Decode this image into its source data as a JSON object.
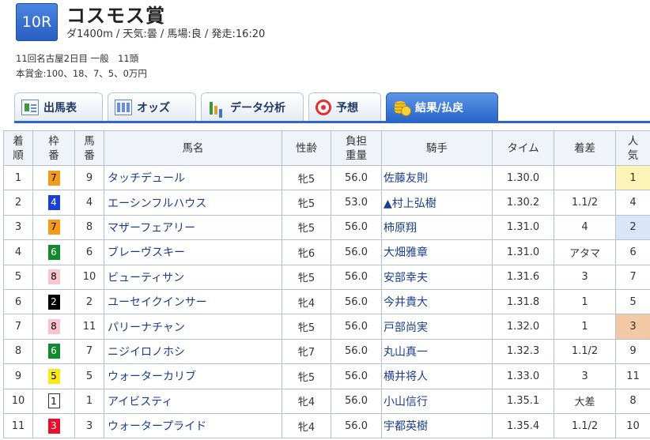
{
  "race": {
    "number": "10R",
    "name": "コスモス賞",
    "conditions": "ダ1400m / 天気:曇 / 馬場:良 / 発走:16:20",
    "meeting": "11回名古屋2日目 一般　11頭",
    "prize": "本賞金:100、18、7、5、0万円"
  },
  "tabs": [
    {
      "label": "出馬表",
      "icon": "race-card-icon"
    },
    {
      "label": "オッズ",
      "icon": "odds-icon"
    },
    {
      "label": "データ分析",
      "icon": "bar-chart-icon"
    },
    {
      "label": "予想",
      "icon": "target-icon"
    },
    {
      "label": "結果/払戻",
      "icon": "coins-icon",
      "active": true
    }
  ],
  "headers": {
    "rank": [
      "着",
      "順"
    ],
    "frame": [
      "枠",
      "番"
    ],
    "horse_no": [
      "馬",
      "番"
    ],
    "horse": "馬名",
    "sex_age": "性齢",
    "weight": [
      "負担",
      "重量"
    ],
    "jockey": "騎手",
    "time": "タイム",
    "margin": "着差",
    "popularity": [
      "人",
      "気"
    ]
  },
  "frame_colors": {
    "1": {
      "bg": "#ffffff",
      "fg": "#000000",
      "border": "#333333"
    },
    "2": {
      "bg": "#000000",
      "fg": "#ffffff"
    },
    "3": {
      "bg": "#e8102a",
      "fg": "#ffffff"
    },
    "4": {
      "bg": "#1a3fd6",
      "fg": "#ffffff"
    },
    "5": {
      "bg": "#f7ea1a",
      "fg": "#000000"
    },
    "6": {
      "bg": "#0f8a2c",
      "fg": "#ffffff"
    },
    "7": {
      "bg": "#f59a1a",
      "fg": "#000000"
    },
    "8": {
      "bg": "#f9c4d0",
      "fg": "#000000"
    }
  },
  "rows": [
    {
      "rank": "1",
      "frame": "7",
      "horse_no": "9",
      "horse": "タッチデュール",
      "sex_age": "牝5",
      "weight": "56.0",
      "jockey": "佐藤友則",
      "time": "1.30.0",
      "margin": "",
      "popularity": "1"
    },
    {
      "rank": "2",
      "frame": "4",
      "horse_no": "4",
      "horse": "エーシンフルハウス",
      "sex_age": "牝5",
      "weight": "53.0",
      "jockey": "▲村上弘樹",
      "time": "1.30.2",
      "margin": "1.1/2",
      "popularity": "4"
    },
    {
      "rank": "3",
      "frame": "7",
      "horse_no": "8",
      "horse": "マザーフェアリー",
      "sex_age": "牝5",
      "weight": "56.0",
      "jockey": "柿原翔",
      "time": "1.31.0",
      "margin": "4",
      "popularity": "2"
    },
    {
      "rank": "4",
      "frame": "6",
      "horse_no": "6",
      "horse": "ブレーヴスキー",
      "sex_age": "牝6",
      "weight": "56.0",
      "jockey": "大畑雅章",
      "time": "1.31.0",
      "margin": "アタマ",
      "popularity": "6"
    },
    {
      "rank": "5",
      "frame": "8",
      "horse_no": "10",
      "horse": "ビューティサン",
      "sex_age": "牝5",
      "weight": "56.0",
      "jockey": "安部幸夫",
      "time": "1.31.6",
      "margin": "3",
      "popularity": "7"
    },
    {
      "rank": "6",
      "frame": "2",
      "horse_no": "2",
      "horse": "ユーセイクインサー",
      "sex_age": "牝4",
      "weight": "56.0",
      "jockey": "今井貴大",
      "time": "1.31.8",
      "margin": "1",
      "popularity": "5"
    },
    {
      "rank": "7",
      "frame": "8",
      "horse_no": "11",
      "horse": "パリーナチャン",
      "sex_age": "牝5",
      "weight": "56.0",
      "jockey": "戸部尚実",
      "time": "1.32.0",
      "margin": "1",
      "popularity": "3"
    },
    {
      "rank": "8",
      "frame": "6",
      "horse_no": "7",
      "horse": "ニジイロノホシ",
      "sex_age": "牝7",
      "weight": "56.0",
      "jockey": "丸山真一",
      "time": "1.32.3",
      "margin": "1.1/2",
      "popularity": "9"
    },
    {
      "rank": "9",
      "frame": "5",
      "horse_no": "5",
      "horse": "ウォーターカリブ",
      "sex_age": "牝5",
      "weight": "56.0",
      "jockey": "横井将人",
      "time": "1.33.0",
      "margin": "3",
      "popularity": "11"
    },
    {
      "rank": "10",
      "frame": "1",
      "horse_no": "1",
      "horse": "アイビスティ",
      "sex_age": "牝4",
      "weight": "56.0",
      "jockey": "小山信行",
      "time": "1.35.1",
      "margin": "大差",
      "popularity": "8"
    },
    {
      "rank": "11",
      "frame": "3",
      "horse_no": "3",
      "horse": "ウォータープライド",
      "sex_age": "牝4",
      "weight": "56.0",
      "jockey": "宇都英樹",
      "time": "1.35.4",
      "margin": "1.1/2",
      "popularity": "10"
    }
  ]
}
